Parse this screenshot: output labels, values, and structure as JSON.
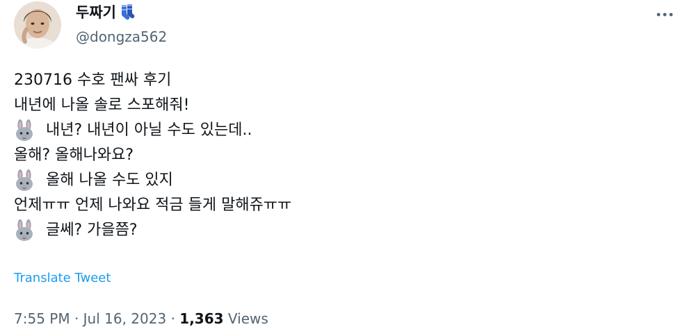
{
  "author": {
    "display_name": "두짜기",
    "name_emoji": "socks-emoji",
    "handle": "@dongza562"
  },
  "tweet": {
    "lines": [
      {
        "emoji": "",
        "text": "230716 수호 팬싸 후기"
      },
      {
        "emoji": "",
        "text": "내년에 나올 솔로 스포해줘!"
      },
      {
        "emoji": "rabbit-emoji",
        "text": "내년? 내년이 아닐 수도 있는데.."
      },
      {
        "emoji": "",
        "text": "올해? 올해나와요?"
      },
      {
        "emoji": "rabbit-emoji",
        "text": "올해 나올 수도 있지"
      },
      {
        "emoji": "",
        "text": "언제ㅠㅠ 언제 나와요 적금 들게 말해쥬ㅠㅠ"
      },
      {
        "emoji": "rabbit-emoji",
        "text": "글쎄? 가을쯤?"
      }
    ],
    "translate_label": "Translate Tweet"
  },
  "meta": {
    "timestamp": "7:55 PM · Jul 16, 2023 · ",
    "views_count": "1,363",
    "views_label": " Views"
  },
  "icons": {
    "more": "more-horizontal-icon"
  },
  "colors": {
    "link": "#1d9bf0",
    "muted": "#536471",
    "text": "#0f1419",
    "background": "#ffffff"
  }
}
